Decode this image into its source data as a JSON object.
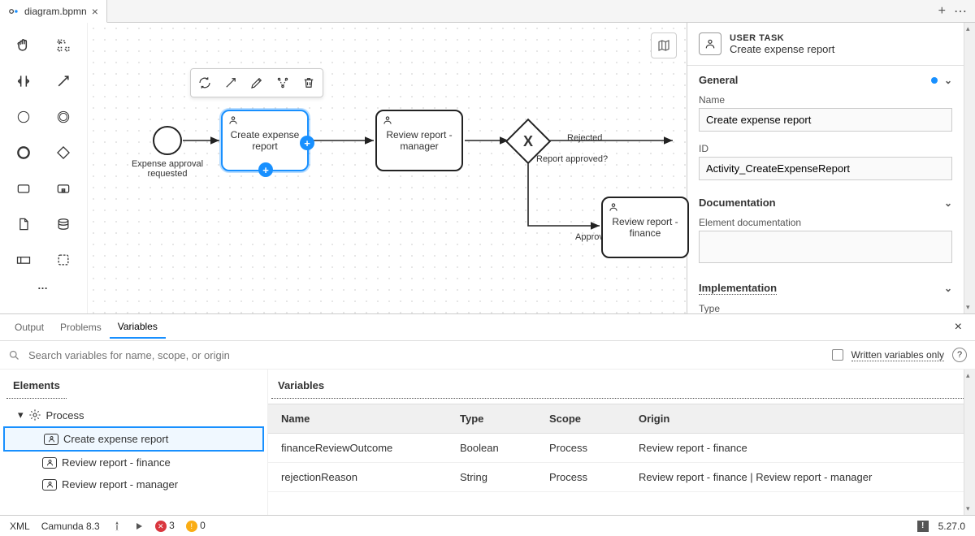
{
  "tab": {
    "title": "diagram.bpmn"
  },
  "canvas": {
    "startLabel": "Expense approval requested",
    "task1": "Create expense report",
    "task2": "Review report - manager",
    "task3": "Review report - finance",
    "gatewayLabel": "Report approved?",
    "edgeRejected": "Rejected",
    "edgeApproved": "Approved"
  },
  "props": {
    "type": "USER TASK",
    "name": "Create expense report",
    "sections": {
      "general": "General",
      "nameLabel": "Name",
      "nameValue": "Create expense report",
      "idLabel": "ID",
      "idValue": "Activity_CreateExpenseReport",
      "doc": "Documentation",
      "docFieldLabel": "Element documentation",
      "docValue": "",
      "impl": "Implementation",
      "typeLabel": "Type"
    }
  },
  "bottom": {
    "tabs": {
      "output": "Output",
      "problems": "Problems",
      "variables": "Variables"
    },
    "searchPlaceholder": "Search variables for name, scope, or origin",
    "writtenOnly": "Written variables only",
    "elementsHeader": "Elements",
    "variablesHeader": "Variables",
    "tree": {
      "process": "Process",
      "t1": "Create expense report",
      "t2": "Review report - finance",
      "t3": "Review report - manager"
    },
    "table": {
      "colName": "Name",
      "colType": "Type",
      "colScope": "Scope",
      "colOrigin": "Origin",
      "rows": [
        {
          "name": "financeReviewOutcome",
          "type": "Boolean",
          "scope": "Process",
          "origin": "Review report - finance"
        },
        {
          "name": "rejectionReason",
          "type": "String",
          "scope": "Process",
          "origin": "Review report - finance | Review report - manager"
        }
      ]
    }
  },
  "status": {
    "xml": "XML",
    "engine": "Camunda 8.3",
    "errors": "3",
    "warnings": "0",
    "version": "5.27.0"
  }
}
